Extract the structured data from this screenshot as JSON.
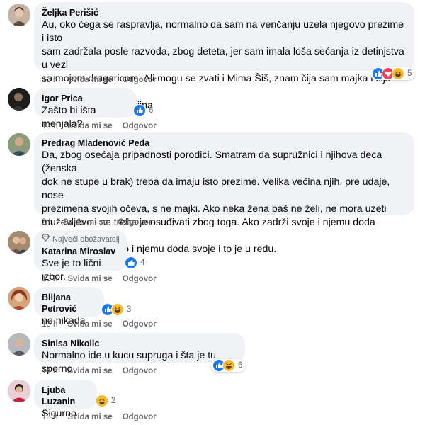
{
  "actions": {
    "like": "Sviđa mi se",
    "reply": "Odgovor"
  },
  "comments": [
    {
      "name": "Željka Perišić",
      "text": "Au, oko čega se raspravlja, normalno da sam na venčanju uzela njegovo prezime i isto\nsam zadržala posle razvoda, zbog deteta, jer sam imala loša sećanja iz detinjstva u vezi\nsa mojom drugaricom. Ali mogu se zvati i Mima Šiš, znam čija sam majka i čija ćerka.\nPrezime ne znači svojina",
      "time": "13 h",
      "reactions": [
        "like",
        "love",
        "haha"
      ],
      "reaction_count": "5"
    },
    {
      "name": "Igor Prica",
      "text": "Zašto bi išta menjala?",
      "time": "13 h",
      "reactions": [
        "like"
      ],
      "reaction_count": "6"
    },
    {
      "name": "Predrag Mladenović Peđa",
      "text": "Da, zbog osećaja pripadnosti porodici. Smatram da supružnici i njihova deca (ženska\ndok ne stupe u brak) treba da imaju isto prezime. Velika većina njih, pre udaje, nose\nprezimena svojih očeva, s ne majki. Ako neka žena baš ne želi, ne mora uzeti\nmuževljevo i ne treba je osuđivati zbog toga. Ako zadrži svoje i njemu doda muževljevo\nili uzme muževljevo i njemu doda svoje i to je u redu.",
      "time": "2 h",
      "reactions": [],
      "reaction_count": ""
    },
    {
      "badge": "Najveći obožavatelj",
      "name": "Katarina Miroslav",
      "text": "Sve je to lični izbor.",
      "time": "13 h",
      "reactions": [
        "like"
      ],
      "reaction_count": "4"
    },
    {
      "name": "Biljana Petrović",
      "text": "ne nikada",
      "time": "13 h",
      "reactions": [
        "like",
        "haha"
      ],
      "reaction_count": "3"
    },
    {
      "name": "Sinisa Nikolic",
      "text": "Normalno ide u kucu supruga i šta je tu sporno",
      "time": "14 h",
      "reactions": [
        "like",
        "haha"
      ],
      "reaction_count": "6"
    },
    {
      "name": "Ljuba Luzanin",
      "text": "Sigurno",
      "time": "13 h",
      "reactions": [
        "haha"
      ],
      "reaction_count": "2"
    }
  ],
  "colors": {
    "bubble": "#f0f2f5",
    "meta_text": "#65676b",
    "like": "#1877f2",
    "love": "#f33e58",
    "haha": "#f7b928"
  }
}
